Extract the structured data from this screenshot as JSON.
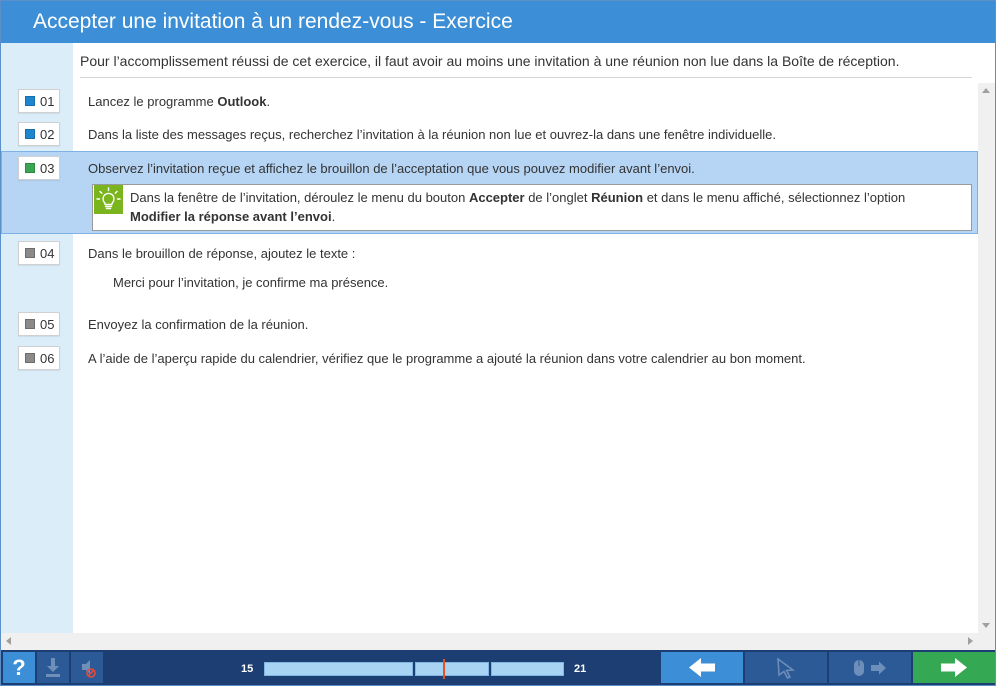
{
  "window": {
    "title": "Accepter une invitation à un rendez-vous - Exercice"
  },
  "intro": "Pour l’accomplissement réussi de cet exercice, il faut avoir au moins une invitation à une réunion non lue dans la Boîte de réception.",
  "steps": [
    {
      "num": "01",
      "status": "done",
      "text_before": "Lancez le programme ",
      "bold": "Outlook",
      "text_after": "."
    },
    {
      "num": "02",
      "status": "done",
      "text": "Dans la liste des messages reçus, recherchez l’invitation à la réunion non lue et ouvrez-la dans une fenêtre individuelle."
    },
    {
      "num": "03",
      "status": "current",
      "text": "Observez l’invitation reçue et affichez le brouillon de l’acceptation que vous pouvez modifier avant l’envoi."
    },
    {
      "num": "04",
      "status": "pending",
      "text": "Dans le brouillon de réponse, ajoutez le texte :",
      "sub_text": "Merci pour l’invitation, je confirme ma présence."
    },
    {
      "num": "05",
      "status": "pending",
      "text": "Envoyez la confirmation de la réunion."
    },
    {
      "num": "06",
      "status": "pending",
      "text": "A l’aide de l’aperçu rapide du calendrier, vérifiez que le programme a ajouté la réunion dans votre calendrier au bon moment."
    }
  ],
  "hint": {
    "part1": "Dans la fenêtre de l’invitation, déroulez le menu du bouton ",
    "bold1": "Accepter",
    "part2": " de l’onglet ",
    "bold2": "Réunion",
    "part3": " et dans le menu affiché, sélectionnez l’option ",
    "bold3": "Modifier la réponse avant l’envoi",
    "part4": "."
  },
  "bottom": {
    "help_label": "?",
    "progress_start": "15",
    "progress_end": "21"
  },
  "colors": {
    "title_bar": "#3c8fd6",
    "bottom_bar": "#1d3e72",
    "done": "#1e86cf",
    "current": "#3aa652",
    "pending": "#8a8a8a",
    "next_button": "#34a853",
    "progress_marker": "#e8501d"
  },
  "icons": {
    "status_done": "blue-square-icon",
    "status_current": "green-square-icon",
    "status_pending": "gray-square-icon",
    "hint": "lightbulb-icon",
    "download": "download-icon",
    "mute": "mute-icon",
    "previous": "arrow-left-icon",
    "select": "cursor-icon",
    "mouse": "mouse-arrow-icon",
    "next": "arrow-right-icon"
  }
}
